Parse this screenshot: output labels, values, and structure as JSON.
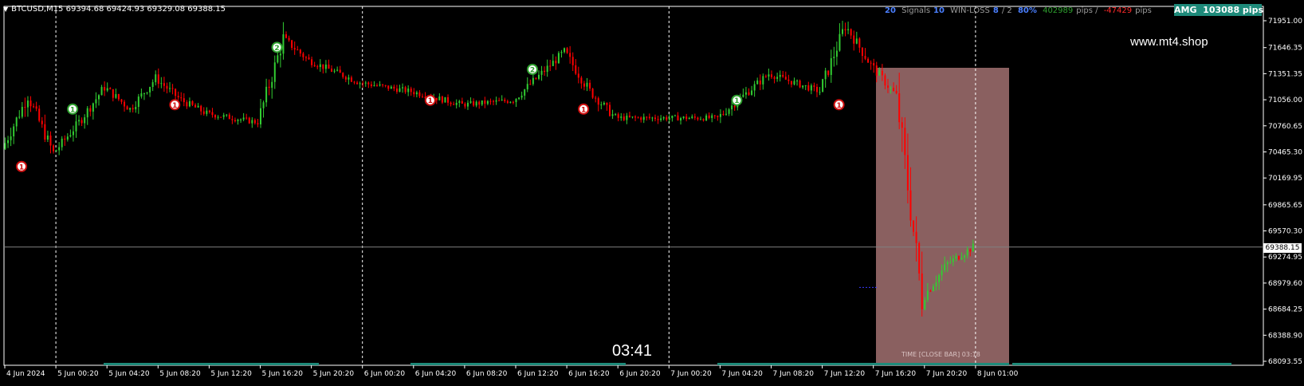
{
  "symbol_info": "BTCUSD,M15  69394.68 69424.93 69329.08 69388.15",
  "stats": {
    "count": "20",
    "signals_label": "Signals",
    "signals_value": "10",
    "winloss_label": "WIN-LOSS",
    "win_value": "8",
    "loss_value": "/ 2",
    "percent": "80%",
    "pips_plus": "402989",
    "pips_label": "pips /",
    "pips_minus": "-47429",
    "pips_suffix": "pips"
  },
  "badge": {
    "label": "AMG",
    "value": "103088 pips"
  },
  "watermark": "www.mt4.shop",
  "countdown": "03:41",
  "close_bar_text": "TIME [CLOSE BAR] 03:18",
  "current_price": "69388.15",
  "price_axis": [
    "71951.00",
    "71646.35",
    "71351.35",
    "71056.00",
    "70760.65",
    "70465.30",
    "70169.95",
    "69865.65",
    "69570.30",
    "69274.95",
    "68979.60",
    "68684.25",
    "68388.90",
    "68093.55"
  ],
  "time_axis": [
    "4 Jun 2024",
    "5 Jun 00:20",
    "5 Jun 04:20",
    "5 Jun 08:20",
    "5 Jun 12:20",
    "5 Jun 16:20",
    "5 Jun 20:20",
    "6 Jun 00:20",
    "6 Jun 04:20",
    "6 Jun 08:20",
    "6 Jun 12:20",
    "6 Jun 16:20",
    "6 Jun 20:20",
    "7 Jun 00:20",
    "7 Jun 04:20",
    "7 Jun 08:20",
    "7 Jun 12:20",
    "7 Jun 16:20",
    "7 Jun 20:20",
    "8 Jun 01:00"
  ],
  "colors": {
    "background": "#000000",
    "bull": "#32cd32",
    "bear": "#ff0000",
    "grid": "#ffffff",
    "shade": "#8a6060",
    "teal": "#1e8a7a",
    "signal_buy": "#2ea02e",
    "signal_sell": "#d01010"
  },
  "chart_data": {
    "type": "candlestick",
    "symbol": "BTCUSD",
    "timeframe": "M15",
    "ylim": [
      68093.55,
      71951.0
    ],
    "last": {
      "open": 69394.68,
      "high": 69424.93,
      "low": 69329.08,
      "close": 69388.15
    },
    "price_path": [
      [
        "4 Jun 2024",
        70500
      ],
      [
        "4 Jun 2024 +",
        71100
      ],
      [
        "5 Jun 00:20",
        70450
      ],
      [
        "5 Jun 00:20 +",
        70800
      ],
      [
        "5 Jun 04:20",
        71200
      ],
      [
        "5 Jun 04:20 +",
        70950
      ],
      [
        "5 Jun 08:20",
        71300
      ],
      [
        "5 Jun 08:20 +",
        71050
      ],
      [
        "5 Jun 12:20",
        70900
      ],
      [
        "5 Jun 16:20",
        70800
      ],
      [
        "5 Jun 16:20 +",
        71750
      ],
      [
        "5 Jun 20:20",
        71500
      ],
      [
        "6 Jun 00:20",
        71250
      ],
      [
        "6 Jun 04:20",
        71150
      ],
      [
        "6 Jun 08:20",
        71000
      ],
      [
        "6 Jun 12:20",
        71050
      ],
      [
        "6 Jun 16:20",
        71600
      ],
      [
        "6 Jun 16:20 +",
        71150
      ],
      [
        "6 Jun 20:20",
        70850
      ],
      [
        "7 Jun 00:20",
        70850
      ],
      [
        "7 Jun 04:20",
        70850
      ],
      [
        "7 Jun 08:20",
        71350
      ],
      [
        "7 Jun 12:20",
        71150
      ],
      [
        "7 Jun 12:20 +",
        71900
      ],
      [
        "7 Jun 16:20",
        71450
      ],
      [
        "7 Jun 16:20 +",
        71100
      ],
      [
        "7 Jun 20:20",
        68800
      ],
      [
        "7 Jun 20:20 +",
        69200
      ],
      [
        "8 Jun 01:00",
        69388.15
      ]
    ],
    "signals": [
      {
        "label": "1",
        "side": "sell",
        "near": "4 Jun 2024",
        "price": 70300
      },
      {
        "label": "1",
        "side": "buy",
        "near": "5 Jun 00:20",
        "price": 70950
      },
      {
        "label": "1",
        "side": "sell",
        "near": "5 Jun 08:20",
        "price": 71000
      },
      {
        "label": "2",
        "side": "buy",
        "near": "5 Jun 16:20",
        "price": 71650
      },
      {
        "label": "1",
        "side": "sell",
        "near": "6 Jun 04:20",
        "price": 71050
      },
      {
        "label": "2",
        "side": "buy",
        "near": "6 Jun 12:20",
        "price": 71400
      },
      {
        "label": "1",
        "side": "sell",
        "near": "6 Jun 16:20",
        "price": 70950
      },
      {
        "label": "1",
        "side": "buy",
        "near": "7 Jun 04:20",
        "price": 71050
      },
      {
        "label": "1",
        "side": "sell",
        "near": "7 Jun 12:20",
        "price": 71000
      }
    ],
    "grid": "vertical day separators"
  }
}
